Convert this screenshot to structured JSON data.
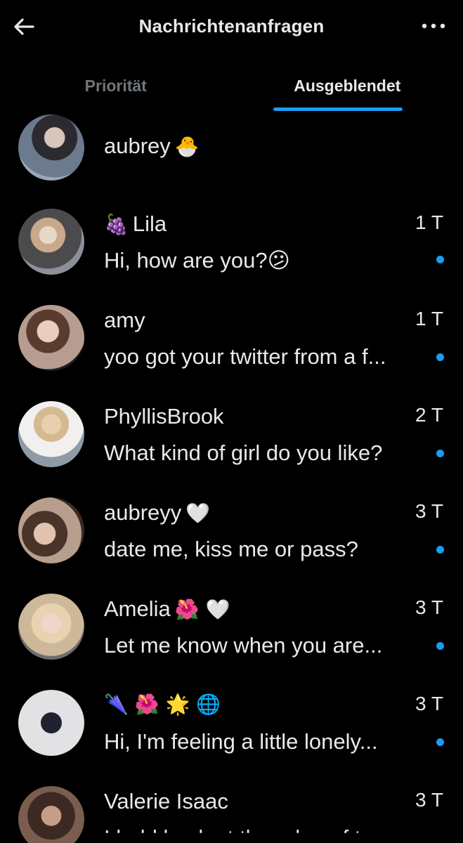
{
  "header": {
    "title": "Nachrichtenanfragen",
    "back_icon": "arrow-left-icon",
    "more_icon": "more-horizontal-icon"
  },
  "tabs": [
    {
      "label": "Priorität",
      "active": false
    },
    {
      "label": "Ausgeblendet",
      "active": true
    }
  ],
  "colors": {
    "accent": "#1d9bf0",
    "background": "#000000",
    "text": "#e7e9ea",
    "muted": "#71767b"
  },
  "conversations": [
    {
      "name": "aubrey",
      "name_emoji": "🐣",
      "time": "",
      "message": "",
      "unread": false
    },
    {
      "name": "Lila",
      "name_emoji_prefix": "🍇",
      "time": "1 T",
      "message": "Hi, how are you?😕",
      "unread": true
    },
    {
      "name": "amy",
      "time": "1 T",
      "message": "yoo got your twitter from a f...",
      "unread": true
    },
    {
      "name": "PhyllisBrook",
      "time": "2 T",
      "message": "What kind of girl do you like?",
      "unread": true
    },
    {
      "name": "aubreyy",
      "name_emoji": "🤍",
      "time": "3 T",
      "message": "date me, kiss me or pass?",
      "unread": true
    },
    {
      "name": "Amelia",
      "name_emoji": "🌺 🤍",
      "time": "3 T",
      "message": "Let me know when you are...",
      "unread": true
    },
    {
      "name": "🌂 🌺 🌟 🌐",
      "time": "3 T",
      "message": "Hi, I'm feeling a little lonely...",
      "unread": true
    },
    {
      "name": "Valerie Isaac",
      "time": "3 T",
      "message": "I held back at the edge of tr...",
      "unread": true
    }
  ]
}
